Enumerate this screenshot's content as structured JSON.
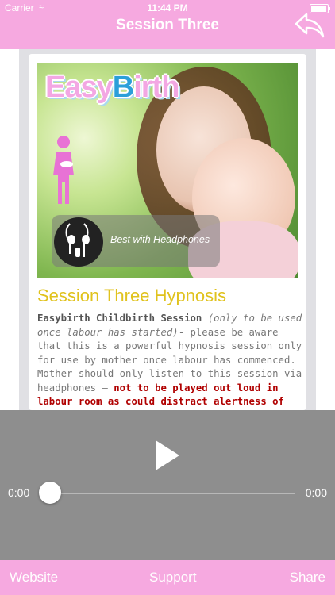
{
  "status_bar": {
    "carrier": "Carrier",
    "time": "11:44 PM"
  },
  "nav": {
    "title": "Session Three",
    "back_icon": "back-arrow-icon"
  },
  "hero": {
    "logo_prefix": "Easy",
    "logo_b": "B",
    "logo_suffix": "irth",
    "headphones_badge": "Best with Headphones"
  },
  "session": {
    "title": "Session Three Hypnosis",
    "label": "Easybirth Childbirth Session",
    "label_note": "(only to be used once labour has started)",
    "body": "- please be aware that this is a powerful hypnosis session only for use by mother once labour has commenced. Mother should only listen to this session via headphones – ",
    "warning": "not to be played out loud in labour room as could distract alertness of birth carers or partners."
  },
  "player": {
    "current_time": "0:00",
    "duration": "0:00",
    "progress": 0
  },
  "bottom_bar": {
    "website": "Website",
    "support": "Support",
    "share": "Share"
  },
  "colors": {
    "accent_pink": "#f6a9e0",
    "title_gold": "#e0c21d",
    "warning_red": "#b00000",
    "player_grey": "#8e8e8e"
  }
}
